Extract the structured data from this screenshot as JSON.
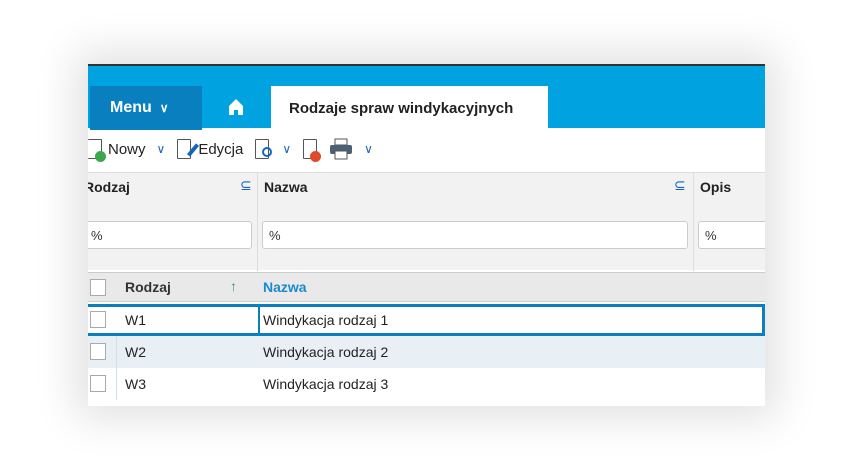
{
  "topbar": {
    "menu_label": "Menu",
    "tab_label": "Rodzaje spraw windykacyjnych"
  },
  "toolbar": {
    "new_label": "Nowy",
    "edit_label": "Edycja"
  },
  "filters": [
    {
      "label": "Rodzaj",
      "value": "%"
    },
    {
      "label": "Nazwa",
      "value": "%"
    },
    {
      "label": "Opis",
      "value": "%"
    }
  ],
  "table": {
    "columns": [
      "Rodzaj",
      "Nazwa"
    ],
    "rows": [
      {
        "rodzaj": "W1",
        "nazwa": "Windykacja rodzaj 1"
      },
      {
        "rodzaj": "W2",
        "nazwa": "Windykacja rodzaj 2"
      },
      {
        "rodzaj": "W3",
        "nazwa": "Windykacja rodzaj 3"
      }
    ]
  },
  "colors": {
    "accent": "#00a2e0",
    "menu": "#0a7fc0"
  }
}
